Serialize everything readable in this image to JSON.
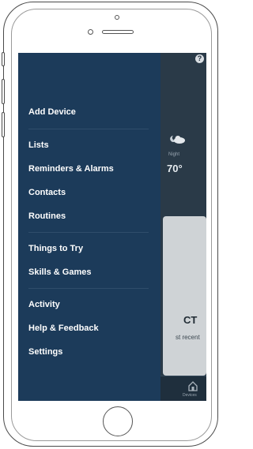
{
  "menu": {
    "items": [
      {
        "label": "Add Device"
      },
      {
        "label": "Lists"
      },
      {
        "label": "Reminders & Alarms"
      },
      {
        "label": "Contacts"
      },
      {
        "label": "Routines"
      },
      {
        "label": "Things to Try"
      },
      {
        "label": "Skills & Games"
      },
      {
        "label": "Activity"
      },
      {
        "label": "Help & Feedback"
      },
      {
        "label": "Settings"
      }
    ]
  },
  "background": {
    "help_icon": "?",
    "weather": {
      "icon": "partly-cloudy-night-icon",
      "label": "Night",
      "temperature": "70°"
    },
    "card": {
      "title": "CT",
      "subtitle": "st recent"
    },
    "bottom_nav": {
      "devices_label": "Devices",
      "icon": "home-icon"
    }
  },
  "colors": {
    "drawer": "#1c3b5a",
    "screen_bg": "#1b2a38",
    "text": "#ffffff",
    "divider": "#2f4d6b"
  }
}
